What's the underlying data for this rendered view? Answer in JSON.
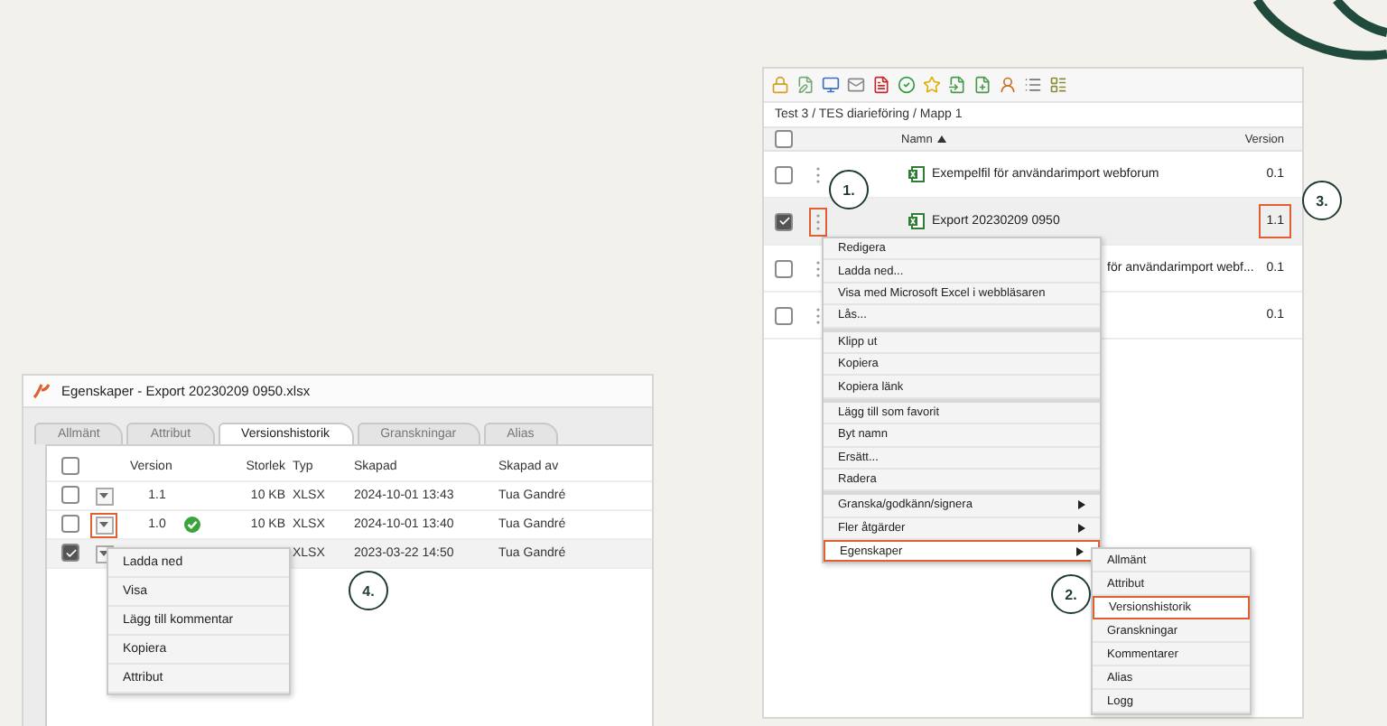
{
  "properties_window": {
    "title": "Egenskaper - Export 20230209 0950.xlsx",
    "tabs": [
      {
        "label": "Allmänt",
        "selected": false
      },
      {
        "label": "Attribut",
        "selected": false
      },
      {
        "label": "Versionshistorik",
        "selected": true
      },
      {
        "label": "Granskningar",
        "selected": false
      },
      {
        "label": "Alias",
        "selected": false
      }
    ],
    "select_all": false,
    "columns": [
      "Version",
      "Storlek",
      "Typ",
      "Skapad",
      "Skapad av"
    ],
    "rows": [
      {
        "checked": false,
        "marked": false,
        "version": "1.1",
        "approved": false,
        "size": "10 KB",
        "type": "XLSX",
        "created": "2024-10-01 13:43",
        "created_by": "Tua Gandré"
      },
      {
        "checked": false,
        "marked": true,
        "version": "1.0",
        "approved": true,
        "size": "10 KB",
        "type": "XLSX",
        "created": "2024-10-01 13:40",
        "created_by": "Tua Gandré"
      },
      {
        "checked": true,
        "marked": false,
        "approved": false,
        "type": "XLSX",
        "created": "2023-03-22 14:50",
        "created_by": "Tua Gandré"
      }
    ],
    "row_menu": [
      "Ladda ned",
      "Visa",
      "Lägg till kommentar",
      "Kopiera",
      "Attribut"
    ]
  },
  "file_browser": {
    "breadcrumb": "Test 3 / TES diarieföring / Mapp 1",
    "select_all": false,
    "columns": [
      "Namn",
      "Version"
    ],
    "rows": [
      {
        "checked": false,
        "selected": false,
        "menu_marked": false,
        "name": "Exempelfil för användarimport webforum",
        "version": "0.1",
        "version_marked": false
      },
      {
        "checked": true,
        "selected": true,
        "menu_marked": true,
        "name": "Export 20230209 0950",
        "version": "1.1",
        "version_marked": true
      },
      {
        "checked": false,
        "selected": false,
        "menu_marked": false,
        "name": "för användarimport webf...",
        "version": "0.1",
        "version_marked": false
      },
      {
        "checked": false,
        "selected": false,
        "menu_marked": false,
        "version": "0.1",
        "version_marked": false
      }
    ],
    "context_menu": [
      [
        {
          "label": "Redigera",
          "submenu": false,
          "marked": false
        },
        {
          "label": "Ladda ned...",
          "submenu": false,
          "marked": false
        },
        {
          "label": "Visa med Microsoft Excel i webbläsaren",
          "submenu": false,
          "marked": false
        },
        {
          "label": "Lås...",
          "submenu": false,
          "marked": false
        }
      ],
      [
        {
          "label": "Klipp ut",
          "submenu": false,
          "marked": false
        },
        {
          "label": "Kopiera",
          "submenu": false,
          "marked": false
        },
        {
          "label": "Kopiera länk",
          "submenu": false,
          "marked": false
        }
      ],
      [
        {
          "label": "Lägg till som favorit",
          "submenu": false,
          "marked": false
        },
        {
          "label": "Byt namn",
          "submenu": false,
          "marked": false
        },
        {
          "label": "Ersätt...",
          "submenu": false,
          "marked": false
        },
        {
          "label": "Radera",
          "submenu": false,
          "marked": false
        }
      ],
      [
        {
          "label": "Granska/godkänn/signera",
          "submenu": true,
          "marked": false
        },
        {
          "label": "Fler åtgärder",
          "submenu": true,
          "marked": false
        },
        {
          "label": "Egenskaper",
          "submenu": true,
          "marked": true
        }
      ]
    ],
    "submenu": [
      {
        "label": "Allmänt",
        "marked": false
      },
      {
        "label": "Attribut",
        "marked": false
      },
      {
        "label": "Versionshistorik",
        "marked": true
      },
      {
        "label": "Granskningar",
        "marked": false
      },
      {
        "label": "Kommentarer",
        "marked": false
      },
      {
        "label": "Alias",
        "marked": false
      },
      {
        "label": "Logg",
        "marked": false
      }
    ]
  },
  "callouts": [
    "1.",
    "2.",
    "3.",
    "4."
  ]
}
